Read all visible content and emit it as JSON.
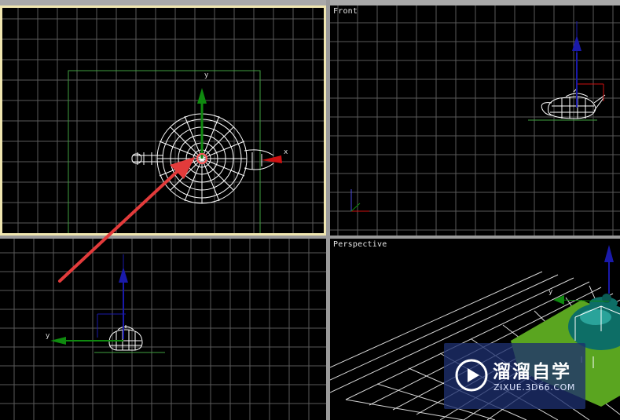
{
  "viewports": {
    "top": {
      "label": ""
    },
    "front": {
      "label": "Front"
    },
    "left": {
      "label": ""
    },
    "perspective": {
      "label": "Perspective"
    }
  },
  "axis_labels": {
    "x": "x",
    "y": "y"
  },
  "watermark": {
    "title": "溜溜自学",
    "subtitle": "ZIXUE.3D66.COM"
  },
  "colors": {
    "grid": "#5a5a5a",
    "active_border": "#f0e6b0",
    "gizmo_x": "#cc1111",
    "gizmo_y": "#0f8a0f",
    "gizmo_z": "#1a1aaa",
    "teapot_shaded": "#0d6e66",
    "ground_plane": "#5aa520",
    "annotation_arrow": "#e23b3b"
  }
}
